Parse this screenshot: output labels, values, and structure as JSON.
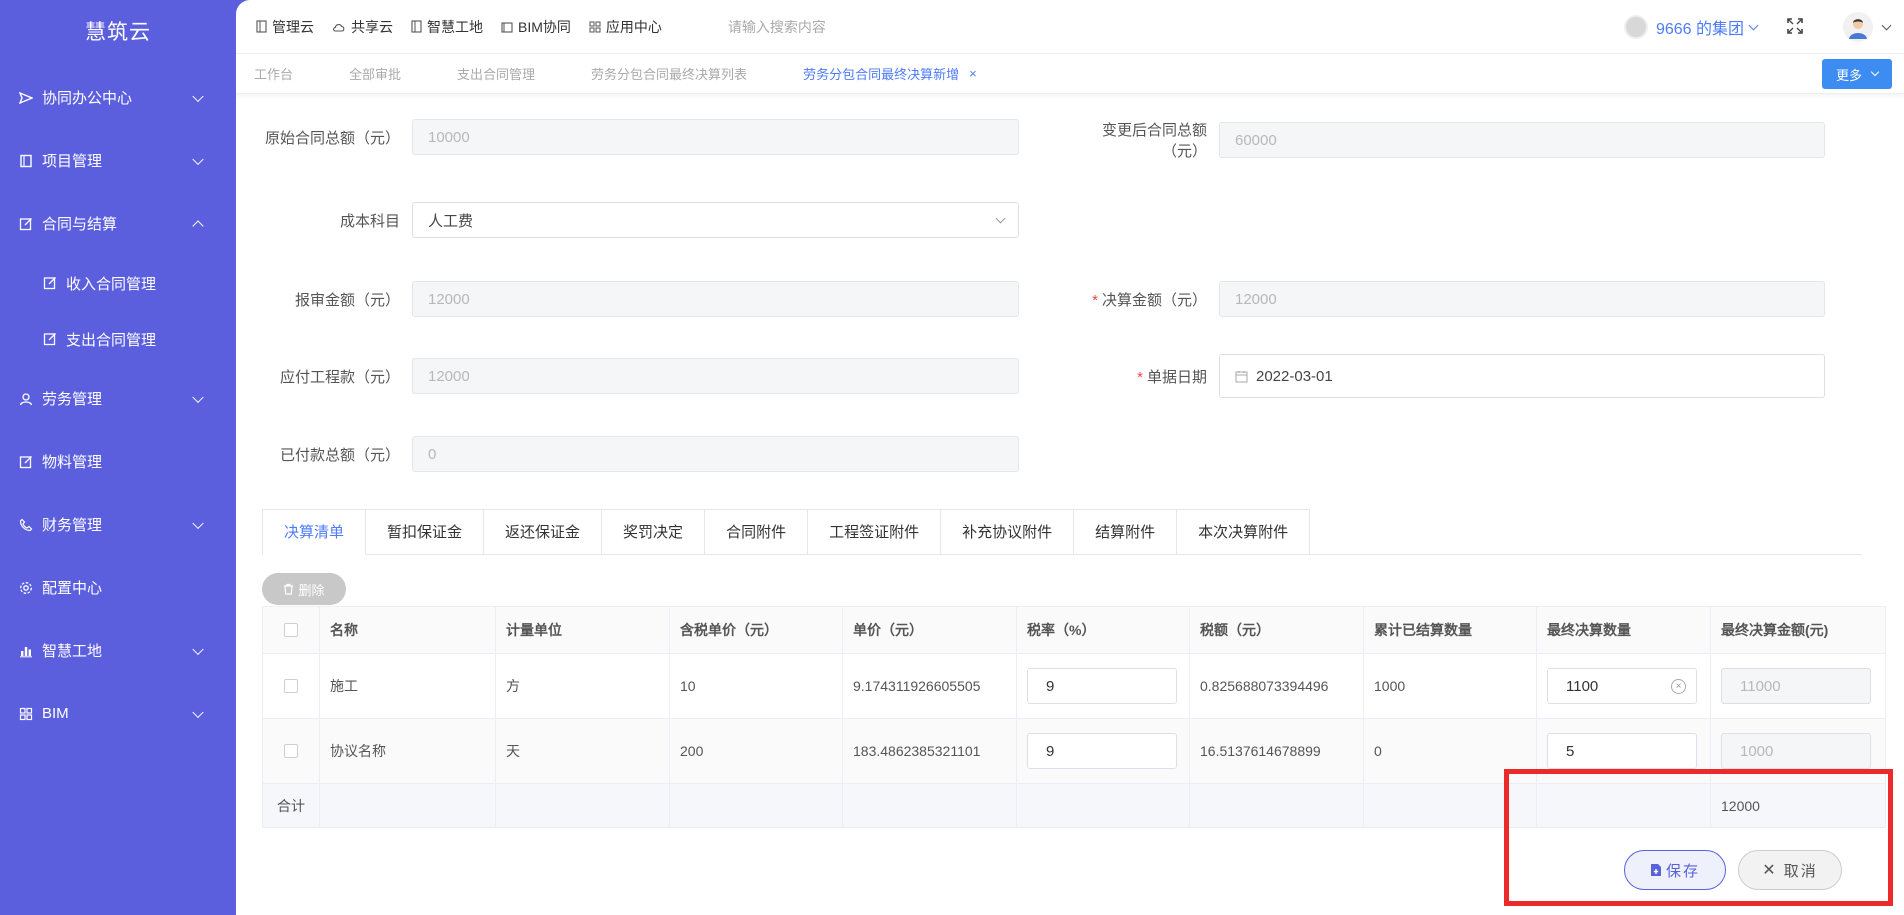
{
  "app": {
    "title": "慧筑云"
  },
  "colors": {
    "sidebar": "#5b5fde",
    "accent": "#4e7cf6",
    "highlight": "#ec2a2a"
  },
  "sidebar": {
    "items": [
      {
        "label": "协同办公中心",
        "icon": "send-icon",
        "expanded": false
      },
      {
        "label": "项目管理",
        "icon": "book-icon",
        "expanded": false
      },
      {
        "label": "合同与结算",
        "icon": "edit-icon",
        "expanded": true
      },
      {
        "label": "收入合同管理",
        "icon": "edit-icon",
        "sub": true
      },
      {
        "label": "支出合同管理",
        "icon": "edit-icon",
        "sub": true
      },
      {
        "label": "劳务管理",
        "icon": "user-icon",
        "expanded": false
      },
      {
        "label": "物料管理",
        "icon": "edit-icon"
      },
      {
        "label": "财务管理",
        "icon": "phone-icon",
        "expanded": false
      },
      {
        "label": "配置中心",
        "icon": "gear-icon"
      },
      {
        "label": "智慧工地",
        "icon": "bar-chart-icon",
        "expanded": false
      },
      {
        "label": "BIM",
        "icon": "grid-icon",
        "expanded": false
      }
    ]
  },
  "topbar": {
    "nav": [
      "管理云",
      "共享云",
      "智慧工地",
      "BIM协同",
      "应用中心"
    ],
    "search_placeholder": "请输入搜索内容",
    "group": "9666 的集团"
  },
  "page_tabs": {
    "items": [
      "工作台",
      "全部审批",
      "支出合同管理",
      "劳务分包合同最终决算列表",
      "劳务分包合同最终决算新增"
    ],
    "close": "×",
    "more": "更多"
  },
  "form": {
    "orig_total_label": "原始合同总额（元）",
    "orig_total_value": "10000",
    "changed_total_label": "变更后合同总额（元）",
    "changed_total_value": "60000",
    "cost_subject_label": "成本科目",
    "cost_subject_value": "人工费",
    "report_amount_label": "报审金额（元）",
    "report_amount_value": "12000",
    "final_amount_label": "决算金额（元）",
    "final_amount_value": "12000",
    "payable_label": "应付工程款（元）",
    "payable_value": "12000",
    "doc_date_label": "单据日期",
    "doc_date_value": "2022-03-01",
    "paid_label": "已付款总额（元）",
    "paid_value": "0",
    "required_mark": "*"
  },
  "sub_tabs": [
    "决算清单",
    "暂扣保证金",
    "返还保证金",
    "奖罚决定",
    "合同附件",
    "工程签证附件",
    "补充协议附件",
    "结算附件",
    "本次决算附件"
  ],
  "delete_label": "删除",
  "table": {
    "headers": [
      "名称",
      "计量单位",
      "含税单价（元）",
      "单价（元）",
      "税率（%）",
      "税额（元）",
      "累计已结算数量",
      "最终决算数量",
      "最终决算金额(元)"
    ],
    "rows": [
      {
        "name": "施工",
        "unit": "方",
        "tax_price": "10",
        "price": "9.174311926605505",
        "rate": "9",
        "tax": "0.825688073394496",
        "settled": "1000",
        "final_qty": "1100",
        "final_amt": "11000"
      },
      {
        "name": "协议名称",
        "unit": "天",
        "tax_price": "200",
        "price": "183.4862385321101",
        "rate": "9",
        "tax": "16.5137614678899",
        "settled": "0",
        "final_qty": "5",
        "final_amt": "1000"
      }
    ],
    "sum_label": "合计",
    "sum_value": "12000"
  },
  "buttons": {
    "save": "保存",
    "cancel": "取消"
  }
}
